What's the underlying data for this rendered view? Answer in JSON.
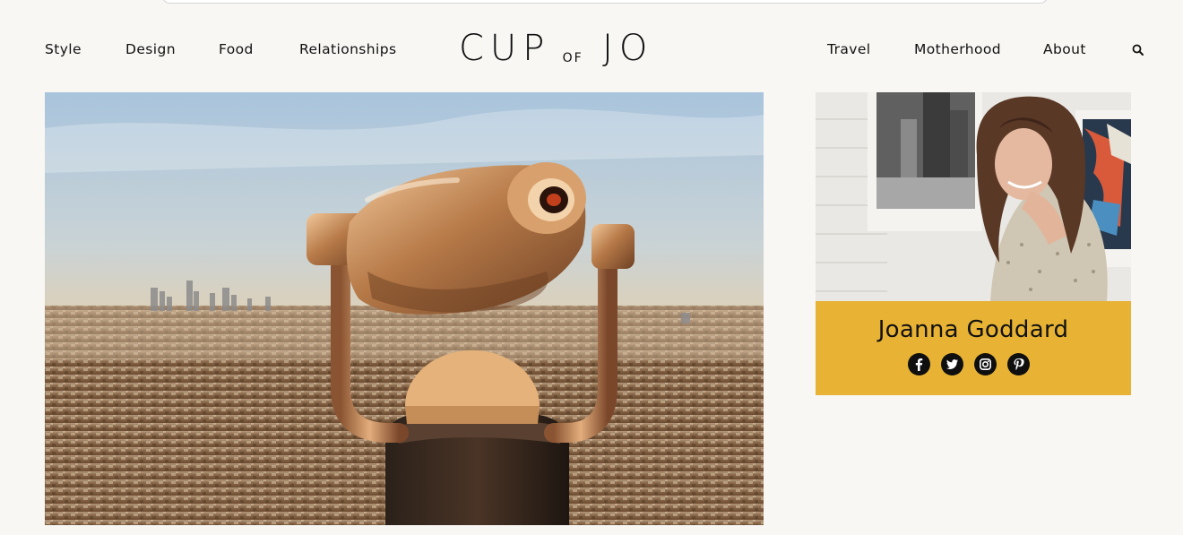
{
  "site": {
    "logo_main_left": "CUP",
    "logo_small": "OF",
    "logo_main_right": "JO"
  },
  "nav": {
    "left": [
      "Style",
      "Design",
      "Food",
      "Relationships"
    ],
    "right": [
      "Travel",
      "Motherhood",
      "About"
    ],
    "search_icon": "search-icon"
  },
  "hero": {
    "image": "coin-operated-binoculars-overlooking-city"
  },
  "profile": {
    "name": "Joanna Goddard",
    "card_color": "#e8b334",
    "socials": [
      "facebook-icon",
      "twitter-icon",
      "instagram-icon",
      "pinterest-icon"
    ]
  }
}
